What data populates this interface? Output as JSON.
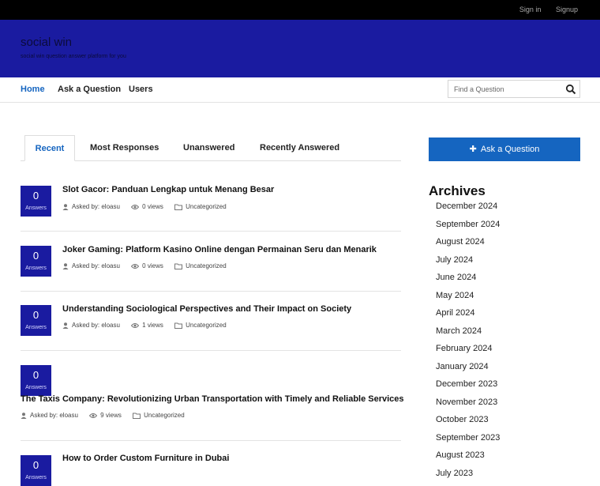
{
  "topbar": {
    "signin": "Sign in",
    "signup": "Signup"
  },
  "site": {
    "title": "social win",
    "tagline": "social win question answer platform for you"
  },
  "nav": {
    "items": [
      "Home",
      "Ask a Question",
      "Users"
    ]
  },
  "search": {
    "placeholder": "Find a Question"
  },
  "tabs": [
    "Recent",
    "Most Responses",
    "Unanswered",
    "Recently Answered"
  ],
  "questions": [
    {
      "answers": "0",
      "answers_label": "Answers",
      "title": "Slot Gacor: Panduan Lengkap untuk Menang Besar",
      "asked_by": "Asked by: eloasu",
      "views": "0 views",
      "category": "Uncategorized"
    },
    {
      "answers": "0",
      "answers_label": "Answers",
      "title": "Joker Gaming: Platform Kasino Online dengan Permainan Seru dan Menarik",
      "asked_by": "Asked by: eloasu",
      "views": "0 views",
      "category": "Uncategorized"
    },
    {
      "answers": "0",
      "answers_label": "Answers",
      "title": "Understanding Sociological Perspectives and Their Impact on Society",
      "asked_by": "Asked by: eloasu",
      "views": "1 views",
      "category": "Uncategorized"
    },
    {
      "answers": "0",
      "answers_label": "Answers",
      "title": "The Taxis Company: Revolutionizing Urban Transportation with Timely and Reliable Services",
      "asked_by": "Asked by: eloasu",
      "views": "9 views",
      "category": "Uncategorized"
    },
    {
      "answers": "0",
      "answers_label": "Answers",
      "title": "How to Order Custom Furniture in Dubai",
      "asked_by": "",
      "views": "",
      "category": ""
    }
  ],
  "sidebar": {
    "ask_button": "Ask a Question",
    "archives_title": "Archives",
    "archives": [
      "December 2024",
      "September 2024",
      "August 2024",
      "July 2024",
      "June 2024",
      "May 2024",
      "April 2024",
      "March 2024",
      "February 2024",
      "January 2024",
      "December 2023",
      "November 2023",
      "October 2023",
      "September 2023",
      "August 2023",
      "July 2023"
    ]
  },
  "colors": {
    "header_blue": "#1a1ba0",
    "accent": "#1565c0"
  }
}
